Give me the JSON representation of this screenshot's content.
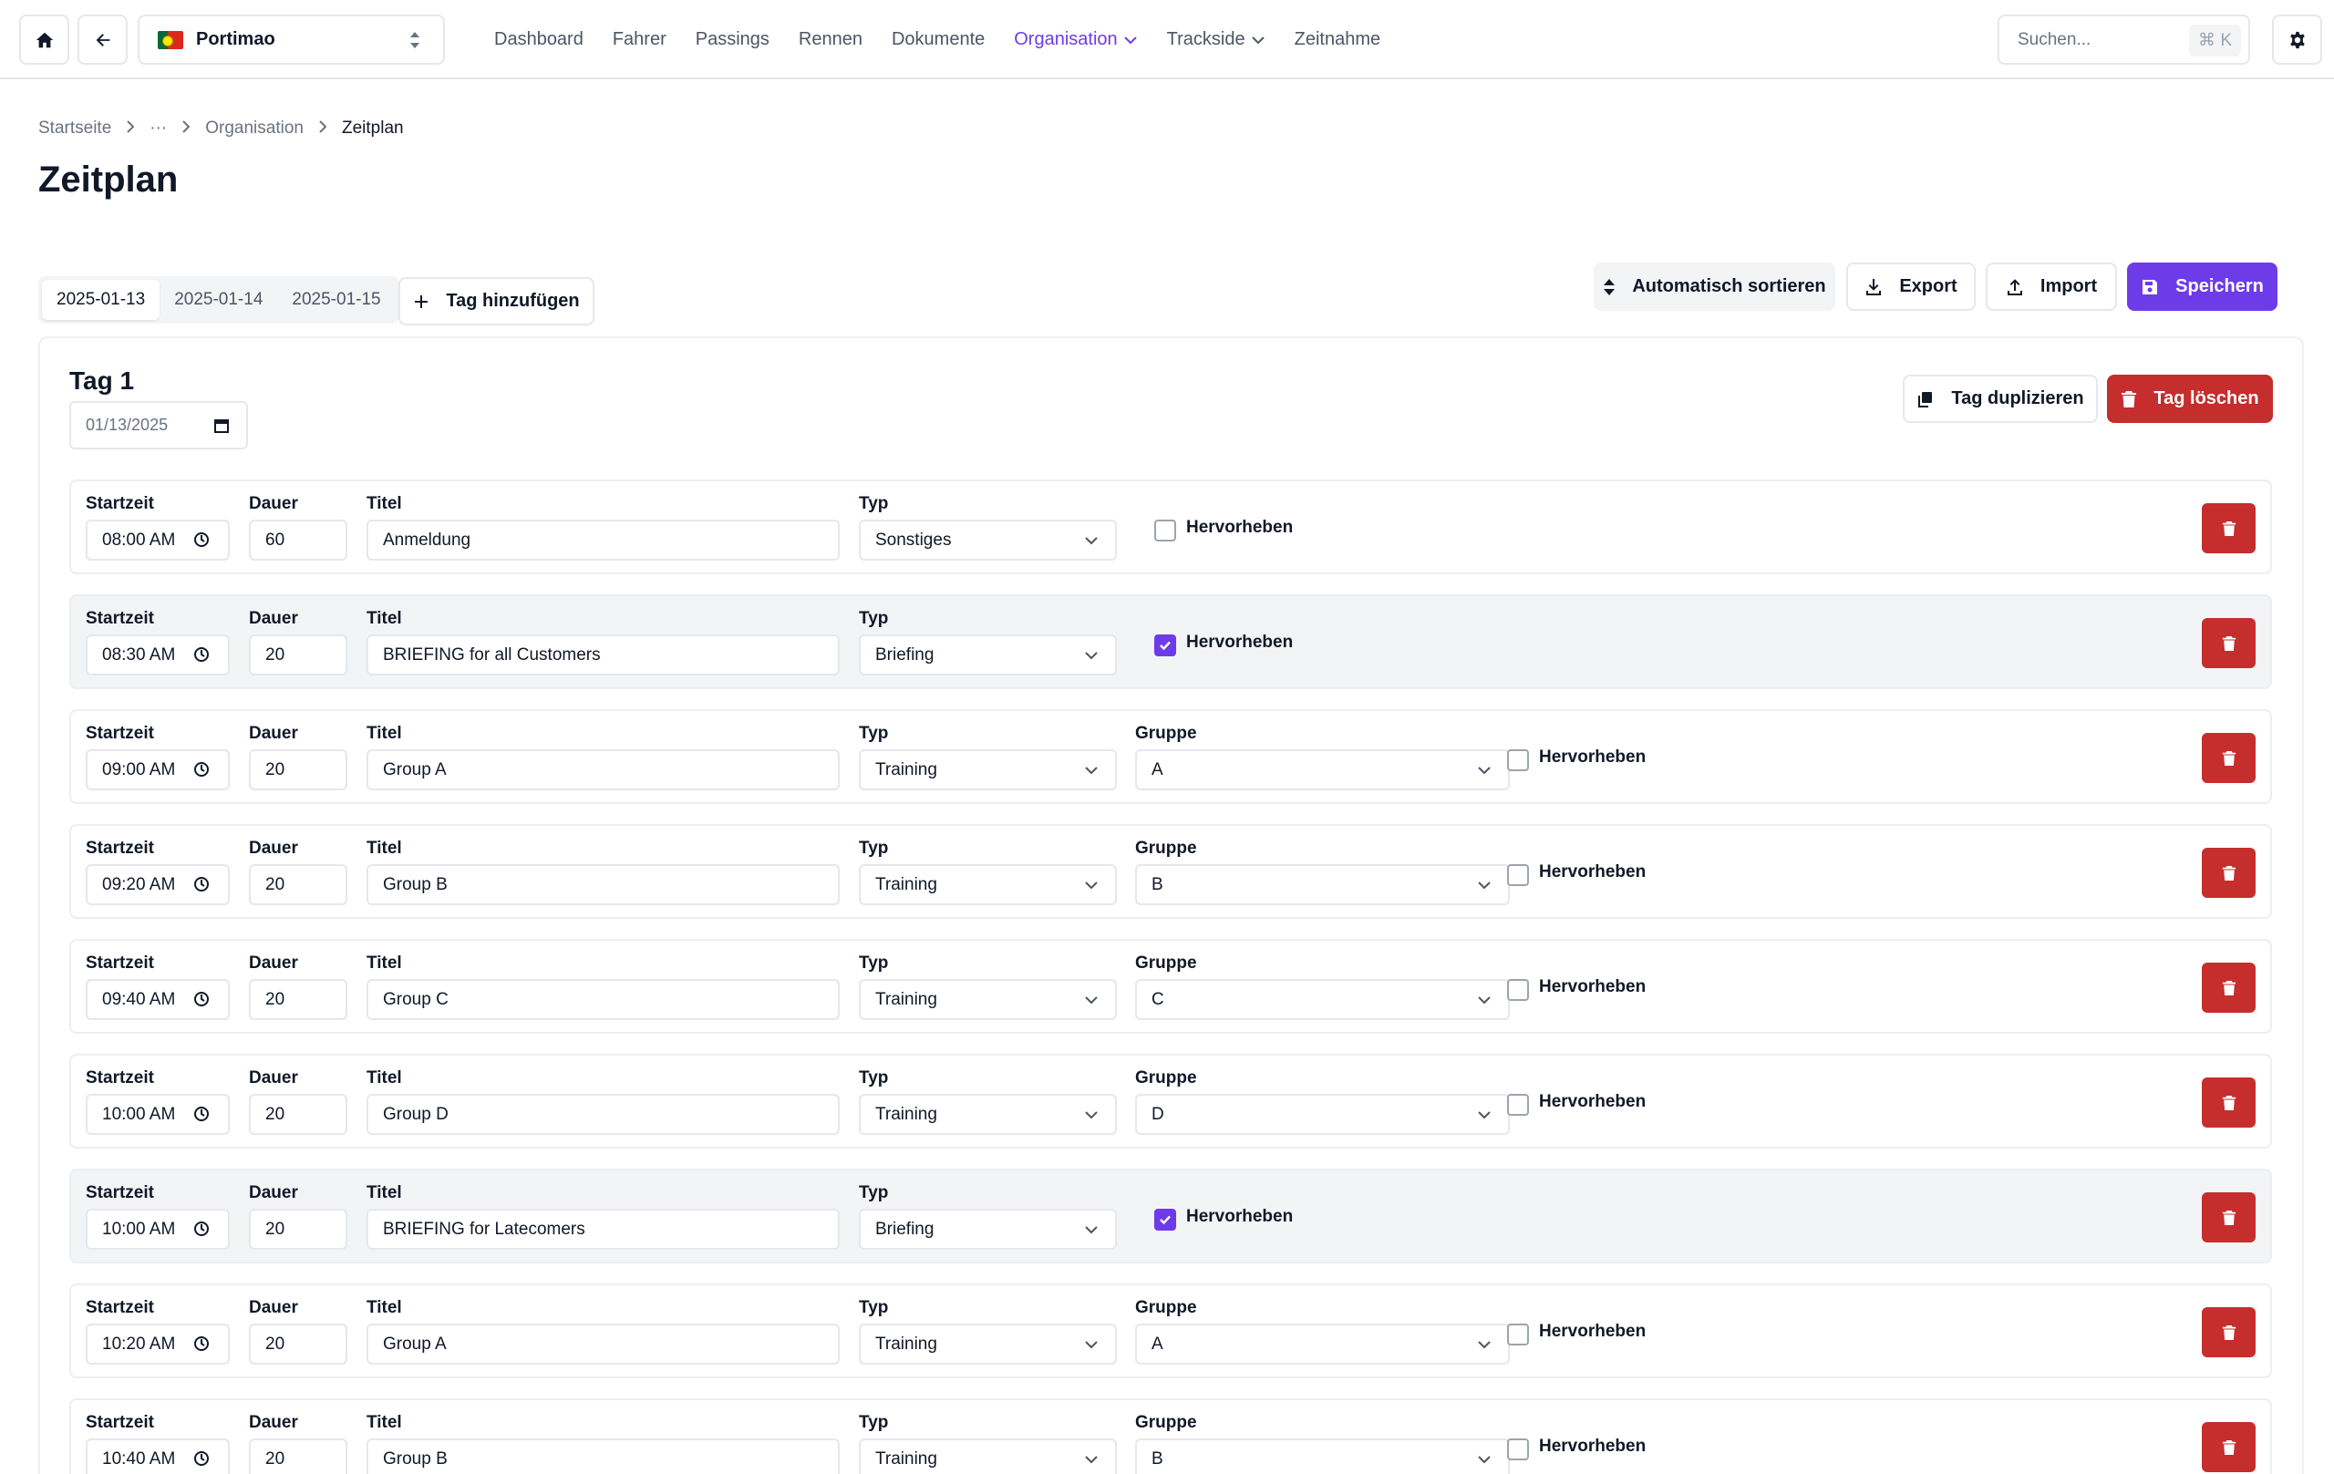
{
  "nav": {
    "track": "Portimao",
    "items": [
      {
        "label": "Dashboard",
        "active": false,
        "dropdown": false
      },
      {
        "label": "Fahrer",
        "active": false,
        "dropdown": false
      },
      {
        "label": "Passings",
        "active": false,
        "dropdown": false
      },
      {
        "label": "Rennen",
        "active": false,
        "dropdown": false
      },
      {
        "label": "Dokumente",
        "active": false,
        "dropdown": false
      },
      {
        "label": "Organisation",
        "active": true,
        "dropdown": true
      },
      {
        "label": "Trackside",
        "active": false,
        "dropdown": true
      },
      {
        "label": "Zeitnahme",
        "active": false,
        "dropdown": false
      }
    ],
    "search_placeholder": "Suchen...",
    "search_shortcut": "⌘ K"
  },
  "breadcrumb": {
    "items": [
      "Startseite",
      "···",
      "Organisation"
    ],
    "current": "Zeitplan"
  },
  "page_title": "Zeitplan",
  "tabs": [
    "2025-01-13",
    "2025-01-14",
    "2025-01-15"
  ],
  "active_tab": 0,
  "add_day_label": "Tag hinzufügen",
  "toolbar": {
    "auto_sort": "Automatisch sortieren",
    "export": "Export",
    "import": "Import",
    "save": "Speichern"
  },
  "day": {
    "title": "Tag 1",
    "date": "01/13/2025",
    "duplicate": "Tag duplizieren",
    "delete": "Tag löschen"
  },
  "labels": {
    "start": "Startzeit",
    "duration": "Dauer",
    "title": "Titel",
    "type": "Typ",
    "group": "Gruppe",
    "highlight": "Hervorheben"
  },
  "rows": [
    {
      "start": "08:00 AM",
      "duration": "60",
      "title": "Anmeldung",
      "type": "Sonstiges",
      "group": null,
      "highlight": false
    },
    {
      "start": "08:30 AM",
      "duration": "20",
      "title": "BRIEFING for all Customers",
      "type": "Briefing",
      "group": null,
      "highlight": true
    },
    {
      "start": "09:00 AM",
      "duration": "20",
      "title": "Group A",
      "type": "Training",
      "group": "A",
      "highlight": false
    },
    {
      "start": "09:20 AM",
      "duration": "20",
      "title": "Group B",
      "type": "Training",
      "group": "B",
      "highlight": false
    },
    {
      "start": "09:40 AM",
      "duration": "20",
      "title": "Group C",
      "type": "Training",
      "group": "C",
      "highlight": false
    },
    {
      "start": "10:00 AM",
      "duration": "20",
      "title": "Group D",
      "type": "Training",
      "group": "D",
      "highlight": false
    },
    {
      "start": "10:00 AM",
      "duration": "20",
      "title": "BRIEFING for Latecomers",
      "type": "Briefing",
      "group": null,
      "highlight": true
    },
    {
      "start": "10:20 AM",
      "duration": "20",
      "title": "Group A",
      "type": "Training",
      "group": "A",
      "highlight": false
    },
    {
      "start": "10:40 AM",
      "duration": "20",
      "title": "Group B",
      "type": "Training",
      "group": "B",
      "highlight": false
    }
  ],
  "colors": {
    "accent": "#6d3ce8",
    "danger": "#c62d2d",
    "highlight_row_bg": "#f3f4f6"
  },
  "icons": {
    "home": "home-icon",
    "back": "arrow-left-icon",
    "settings": "gear-icon",
    "sort": "sort-icon",
    "export": "download-icon",
    "import": "upload-icon",
    "save": "floppy-disk-icon",
    "duplicate": "copy-icon",
    "delete": "trash-icon",
    "clock": "clock-icon",
    "calendar": "calendar-icon",
    "chevron": "chevron-down-icon"
  }
}
